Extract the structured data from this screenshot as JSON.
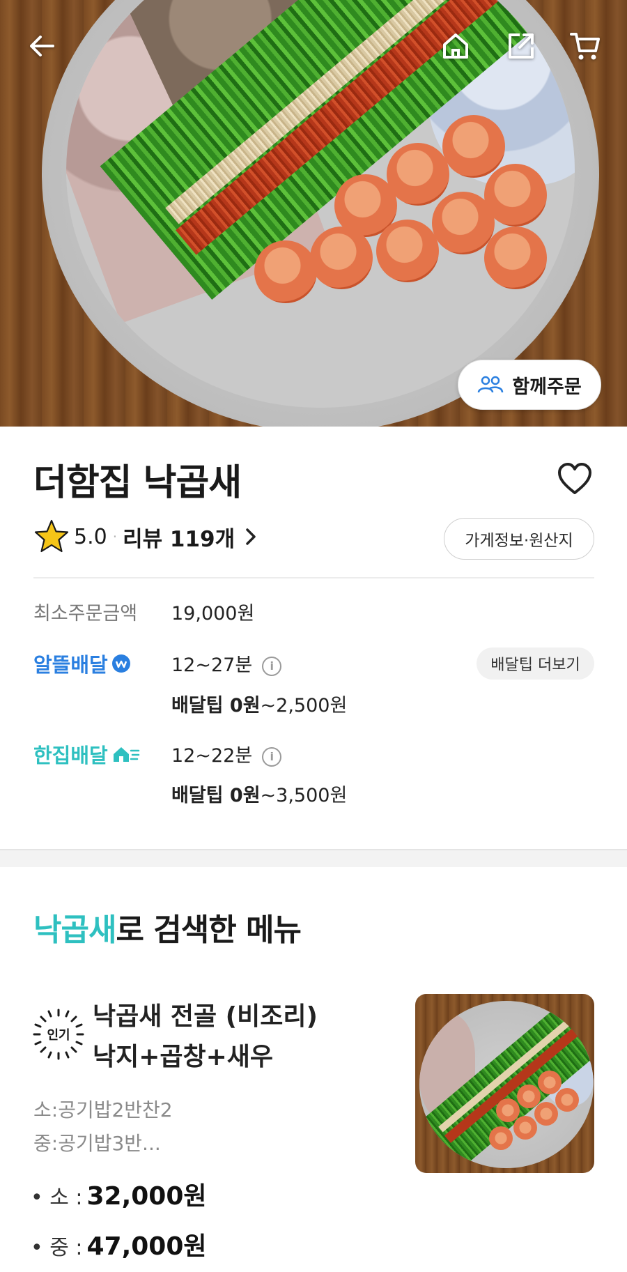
{
  "hero": {
    "image_icon": "food-photo",
    "group_order_label": "함께주문"
  },
  "store": {
    "name": "더함집 낙곱새",
    "rating": "5.0",
    "review_label": "리뷰 119개",
    "info_button_label": "가게정보·원산지"
  },
  "order_info": {
    "min_order_label": "최소주문금액",
    "min_order_value": "19,000원",
    "delivery_options": [
      {
        "brand": "알뜰배달",
        "time": "12~27분",
        "tip_bold": "배달팁 0원",
        "tip_rest": "~2,500원"
      },
      {
        "brand": "한집배달",
        "time": "12~22분",
        "tip_bold": "배달팁 0원",
        "tip_rest": "~3,500원"
      }
    ],
    "tip_more_label": "배달팁 더보기"
  },
  "menu_section": {
    "title_highlight": "낙곱새",
    "title_rest": "로 검색한 메뉴",
    "item": {
      "badge": "인기",
      "name_line1": "낙곱새 전골 (비조리)",
      "name_line2": "낙지+곱창+새우",
      "desc_line1": "소:공기밥2반찬2",
      "desc_line2": "중:공기밥3반...",
      "prices": [
        {
          "size": "• 소 :",
          "value": "32,000원"
        },
        {
          "size": "• 중 :",
          "value": "47,000원"
        }
      ]
    }
  },
  "colors": {
    "teal": "#2ec0c0",
    "blue": "#2a7fe0",
    "star": "#f5c518"
  }
}
